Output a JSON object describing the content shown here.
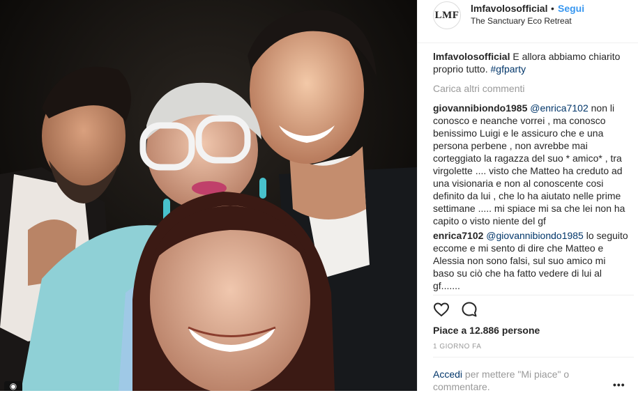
{
  "post": {
    "username": "lmfavolosofficial",
    "separator": "•",
    "follow_label": "Segui",
    "location": "The Sanctuary Eco Retreat",
    "avatar_text": "LMF"
  },
  "caption": {
    "username": "lmfavolosofficial",
    "text": " E allora abbiamo chiarito proprio tutto. ",
    "hashtag": "#gfparty"
  },
  "load_more_label": "Carica altri commenti",
  "comments": [
    {
      "username": "giovannibiondo1985",
      "mention": "@enrica7102",
      "text": " non li conosco e neanche vorrei , ma conosco benissimo Luigi e le assicuro che e una persona perbene , non avrebbe mai corteggiato la ragazza del suo * amico* , tra virgolette .... visto che Matteo ha creduto ad una visionaria e non al conoscente cosi definito da lui , che lo ha aiutato nelle prime settimane ..... mi spiace mi sa che lei non ha capito o visto niente del gf"
    },
    {
      "username": "enrica7102",
      "mention": "@giovannibiondo1985",
      "text": " lo seguito eccome e mi sento di dire che Matteo e Alessia non sono falsi, sul suo amico mi baso su ciò che ha fatto vedere di lui al gf......."
    }
  ],
  "likes": "Piace a 12.886 persone",
  "timestamp": "1 GIORNO FA",
  "login": {
    "link": "Accedi",
    "text": " per mettere \"Mi piace\" o commentare."
  },
  "options_label": "•••",
  "icons": {
    "like": "heart-icon",
    "comment": "comment-bubble-icon",
    "photo_badge": "camera-icon",
    "more": "more-options-icon"
  },
  "colors": {
    "link_blue": "#3897f0",
    "mention_dark": "#003569",
    "muted": "#999999"
  }
}
